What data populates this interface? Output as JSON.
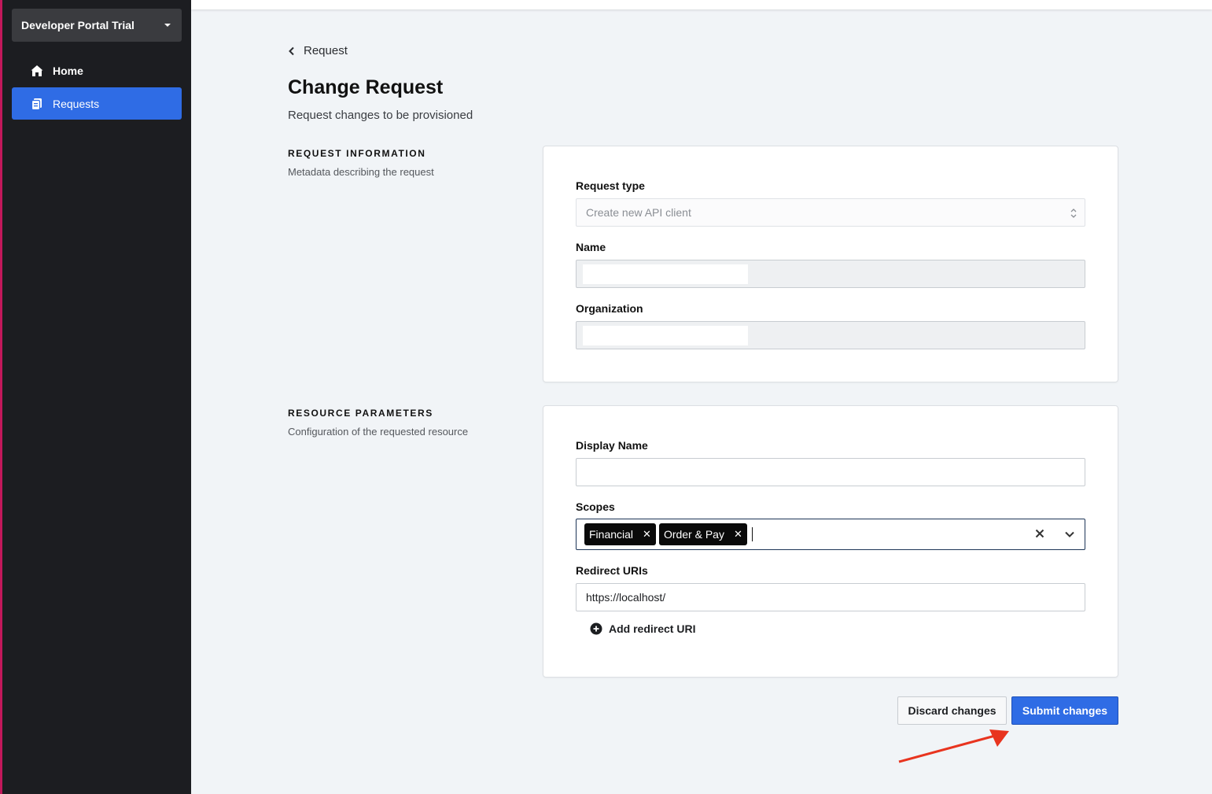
{
  "sidebar": {
    "workspace": "Developer Portal Trial",
    "items": [
      {
        "label": "Home",
        "icon": "home-icon"
      },
      {
        "label": "Requests",
        "icon": "document-icon",
        "active": true
      }
    ]
  },
  "back_link": "Request",
  "page": {
    "title": "Change Request",
    "subtitle": "Request changes to be provisioned"
  },
  "sections": {
    "request_information": {
      "title": "REQUEST INFORMATION",
      "description": "Metadata describing the request",
      "fields": {
        "request_type": {
          "label": "Request type",
          "value": "Create new API client"
        },
        "name": {
          "label": "Name",
          "value": ""
        },
        "organization": {
          "label": "Organization",
          "value": ""
        }
      }
    },
    "resource_parameters": {
      "title": "RESOURCE PARAMETERS",
      "description": "Configuration of the requested resource",
      "fields": {
        "display_name": {
          "label": "Display Name",
          "value": ""
        },
        "scopes": {
          "label": "Scopes",
          "selected": [
            "Financial",
            "Order & Pay"
          ]
        },
        "redirect_uris": {
          "label": "Redirect URIs",
          "value": "https://localhost/"
        },
        "add_redirect_label": "Add redirect URI"
      }
    }
  },
  "actions": {
    "discard_label": "Discard changes",
    "submit_label": "Submit changes"
  },
  "colors": {
    "accent": "#2f6ce5",
    "sidebar_bg": "#1c1d21",
    "annotation_arrow": "#e8341f"
  }
}
